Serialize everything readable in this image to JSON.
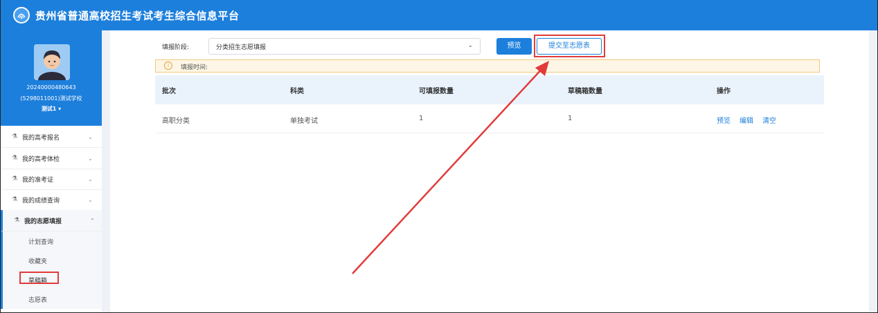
{
  "app": {
    "title": "贵州省普通高校招生考试考生综合信息平台"
  },
  "profile": {
    "user_id": "20240000480643",
    "school": "(5298011001)测试学校",
    "name": "测试1 ▾"
  },
  "sidebar": {
    "items": [
      {
        "label": "我的高考报名",
        "chevron": "⌄"
      },
      {
        "label": "我的高考体检",
        "chevron": "⌄"
      },
      {
        "label": "我的准考证",
        "chevron": "⌄"
      },
      {
        "label": "我的成绩查询",
        "chevron": "⌄"
      },
      {
        "label": "我的志愿填报",
        "chevron": "⌃"
      }
    ],
    "sub_items": [
      {
        "label": "计划查询"
      },
      {
        "label": "收藏夹"
      },
      {
        "label": "草稿箱"
      },
      {
        "label": "志愿表"
      }
    ]
  },
  "form": {
    "stage_label": "填报阶段:",
    "stage_value": "分类招生志愿填报",
    "preview_button": "预览",
    "submit_button": "提交至志愿表"
  },
  "notice": {
    "text": "填报时间:"
  },
  "table": {
    "headers": [
      "批次",
      "科类",
      "可填报数量",
      "草稿箱数量",
      "操作"
    ],
    "rows": [
      {
        "batch": "高职分类",
        "category": "单独考试",
        "available": "1",
        "draft": "1",
        "actions": [
          "预览",
          "编辑",
          "清空"
        ]
      }
    ]
  },
  "colors": {
    "primary": "#1d7fdc",
    "highlight": "#e23a3a",
    "notice_bg": "#fdf6e6"
  }
}
